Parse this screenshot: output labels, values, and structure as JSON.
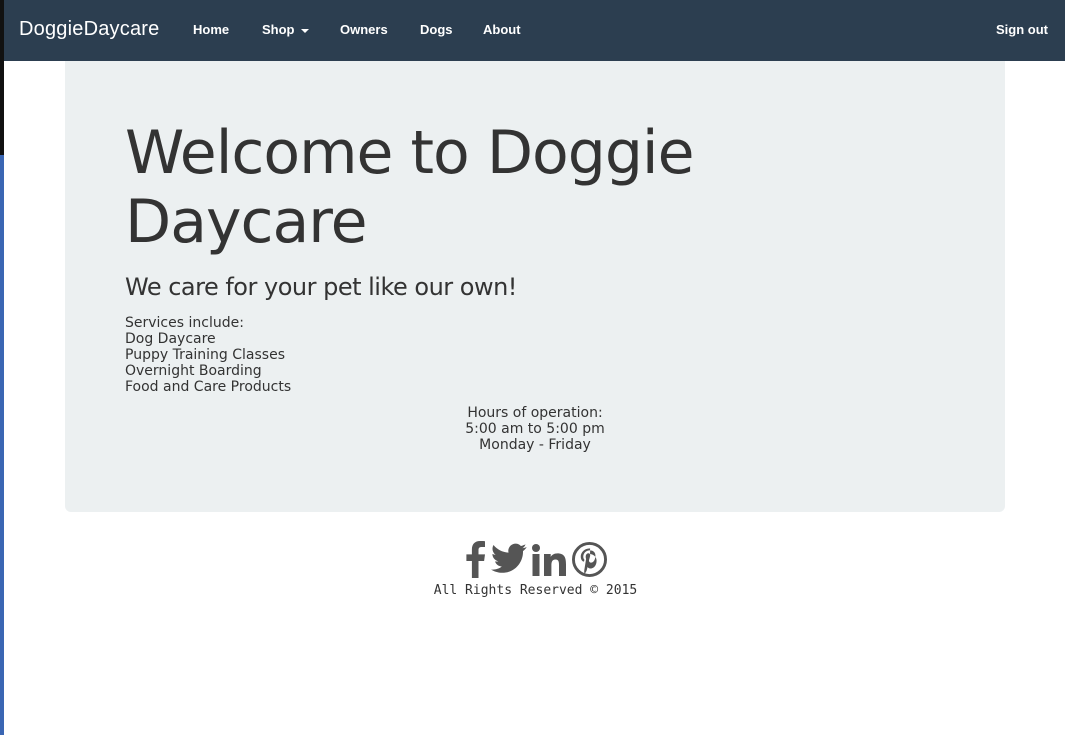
{
  "navbar": {
    "brand": "DoggieDaycare",
    "items": [
      {
        "label": "Home"
      },
      {
        "label": "Shop"
      },
      {
        "label": "Owners"
      },
      {
        "label": "Dogs"
      },
      {
        "label": "About"
      }
    ],
    "sign_out": "Sign out"
  },
  "jumbotron": {
    "title": "Welcome to Doggie Daycare",
    "subtitle": "We care for your pet like our own!",
    "services": [
      "Services include:",
      "Dog Daycare",
      "Puppy Training Classes",
      "Overnight Boarding",
      "Food and Care Products"
    ],
    "hours": [
      "Hours of operation:",
      "5:00 am to 5:00 pm",
      "Monday - Friday"
    ]
  },
  "footer": {
    "social_icons": [
      "facebook-icon",
      "twitter-icon",
      "linkedin-icon",
      "pinterest-icon"
    ],
    "copyright": "All Rights Reserved © 2015"
  },
  "colors": {
    "navbar_bg": "#2c3e50",
    "jumbotron_bg": "#ecf0f1",
    "icon_color": "#555555"
  }
}
